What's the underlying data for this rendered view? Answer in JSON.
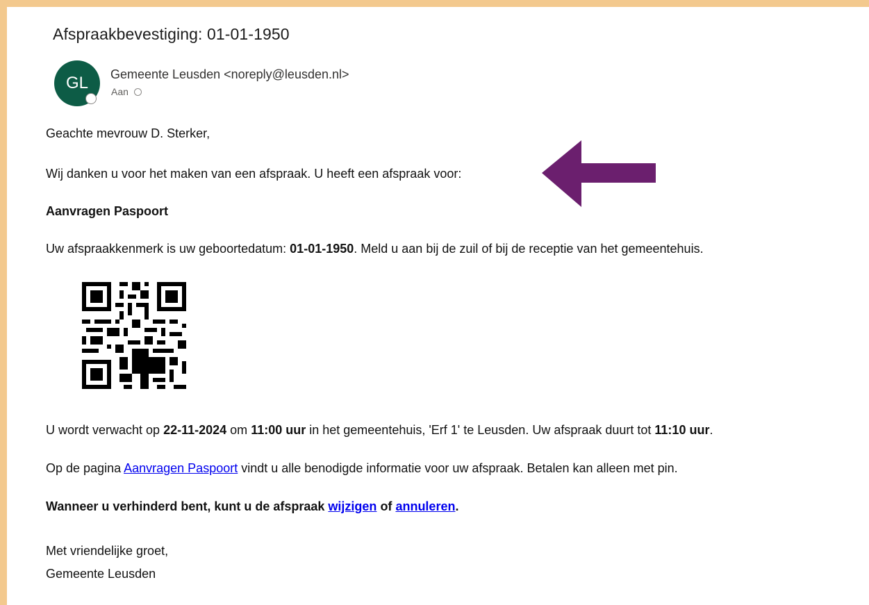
{
  "email": {
    "subject": "Afspraakbevestiging: 01-01-1950",
    "sender": {
      "initials": "GL",
      "display": "Gemeente Leusden <noreply@leusden.nl>"
    },
    "to_label": "Aan",
    "avatar_color": "#0d5c46"
  },
  "body": {
    "greeting": "Geachte mevrouw D. Sterker,",
    "thanks": "Wij danken u voor het maken van een afspraak. U heeft een afspraak voor:",
    "appointment_type": "Aanvragen Paspoort",
    "ref_prefix": "Uw afspraakkenmerk is uw geboortedatum: ",
    "ref_value": "01-01-1950",
    "ref_suffix": ". Meld u aan bij de zuil of bij de receptie van het gemeentehuis.",
    "expect_1": "U wordt verwacht op ",
    "date": "22-11-2024",
    "expect_2": " om ",
    "time": "11:00 uur",
    "expect_3": " in het gemeentehuis, 'Erf 1' te Leusden. Uw afspraak duurt tot ",
    "end_time": "11:10 uur",
    "expect_4": ".",
    "info_prefix": "Op de pagina ",
    "info_link": "Aanvragen Paspoort",
    "info_suffix": " vindt u alle benodigde informatie voor uw afspraak. Betalen kan alleen met pin.",
    "change_prefix": "Wanneer u verhinderd bent, kunt u de afspraak ",
    "change_link": "wijzigen",
    "change_mid": " of ",
    "cancel_link": "annuleren",
    "change_suffix": ".",
    "closing": "Met vriendelijke groet,",
    "signature": "Gemeente Leusden"
  },
  "colors": {
    "frame_border": "#f3c98e",
    "arrow": "#6b1f6e",
    "link": "#0000ee"
  }
}
